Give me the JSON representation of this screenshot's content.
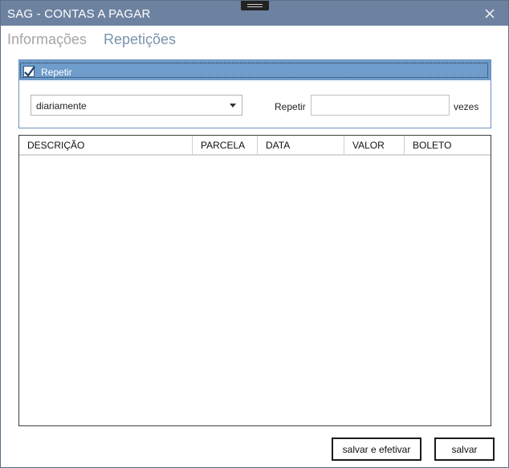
{
  "window": {
    "title": "SAG - CONTAS A PAGAR",
    "titlebar_color": "#6d82a0"
  },
  "tabs": [
    {
      "label": "Informações",
      "active": false
    },
    {
      "label": "Repetições",
      "active": true
    }
  ],
  "repeat_group": {
    "checkbox_label": "Repetir",
    "checked": true,
    "frequency_selected": "diariamente",
    "repeat_label": "Repetir",
    "repeat_value": "",
    "times_label": "vezes",
    "header_color": "#6e9ccb"
  },
  "table": {
    "columns": [
      "DESCRIÇÃO",
      "PARCELA",
      "DATA",
      "VALOR",
      "BOLETO"
    ],
    "rows": []
  },
  "buttons": {
    "save_and_commit": "salvar e efetivar",
    "save": "salvar"
  },
  "icons": {
    "close": "close-icon",
    "check": "checkmark-icon",
    "dropdown": "chevron-down-icon",
    "grip": "drag-grip-icon"
  }
}
